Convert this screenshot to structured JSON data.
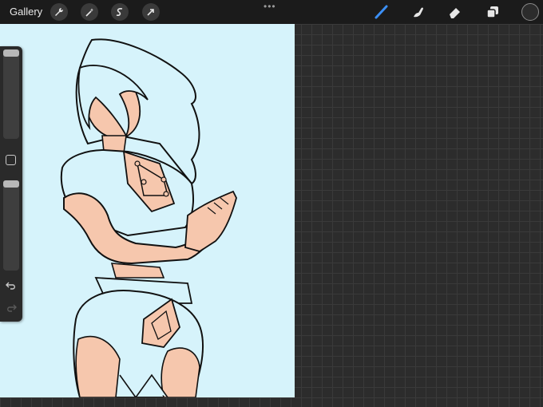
{
  "topbar": {
    "gallery_label": "Gallery",
    "left_tools": [
      {
        "icon": "wrench-icon",
        "name": "actions"
      },
      {
        "icon": "magic-wand-icon",
        "name": "adjustments"
      },
      {
        "icon": "selection-icon",
        "name": "selection"
      },
      {
        "icon": "transform-arrow-icon",
        "name": "transform"
      }
    ],
    "more_glyph": "•••",
    "right_tools": [
      {
        "icon": "brush-icon",
        "name": "brush",
        "active": true
      },
      {
        "icon": "smudge-icon",
        "name": "smudge"
      },
      {
        "icon": "eraser-icon",
        "name": "eraser"
      },
      {
        "icon": "layers-icon",
        "name": "layers"
      }
    ],
    "current_color": "#2c2c2c",
    "accent_color": "#3b8ff5"
  },
  "sidebar": {
    "brush_size_level": 0.0,
    "opacity_level": 0.0,
    "undo_icon": "undo-icon",
    "redo_icon": "redo-icon"
  },
  "canvas": {
    "background_color": "#d6f3fb"
  }
}
